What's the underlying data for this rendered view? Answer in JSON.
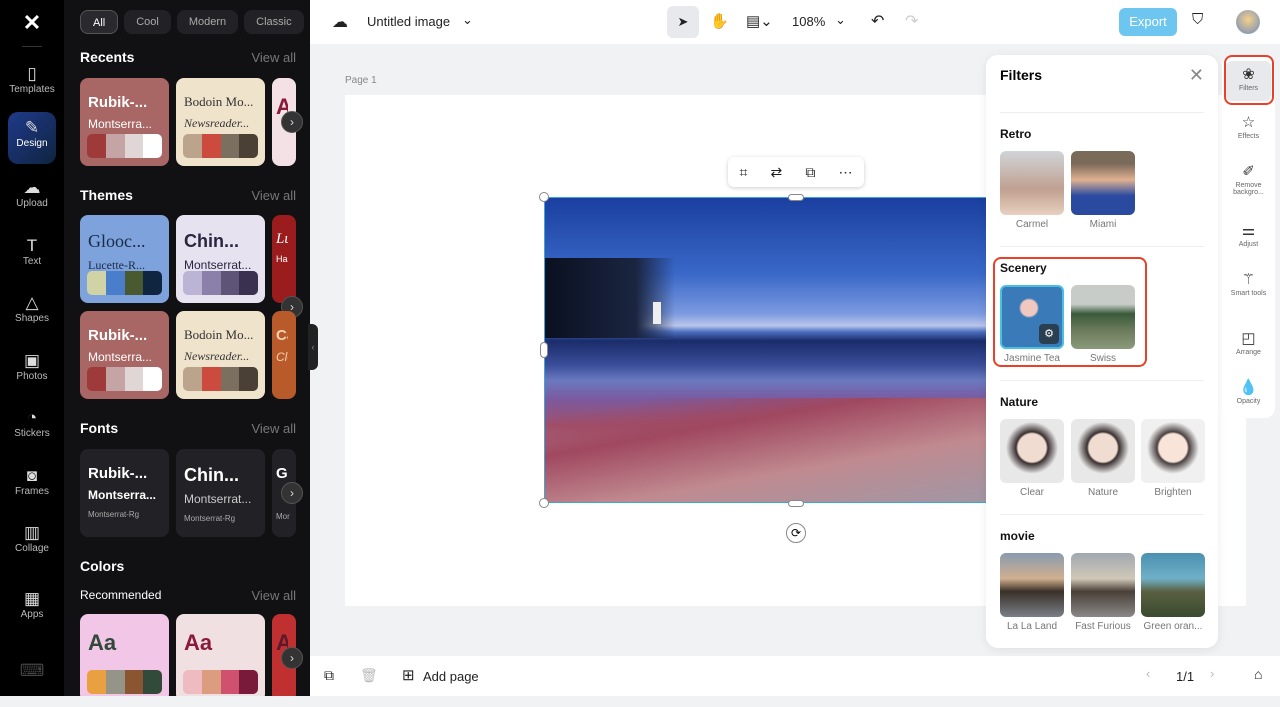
{
  "rail": {
    "items": [
      {
        "label": "Templates",
        "icon": "templates-icon"
      },
      {
        "label": "Design",
        "icon": "design-icon"
      },
      {
        "label": "Upload",
        "icon": "upload-icon"
      },
      {
        "label": "Text",
        "icon": "text-icon"
      },
      {
        "label": "Shapes",
        "icon": "shapes-icon"
      },
      {
        "label": "Photos",
        "icon": "photos-icon"
      },
      {
        "label": "Stickers",
        "icon": "stickers-icon"
      },
      {
        "label": "Frames",
        "icon": "frames-icon"
      },
      {
        "label": "Collage",
        "icon": "collage-icon"
      },
      {
        "label": "Apps",
        "icon": "apps-icon"
      }
    ]
  },
  "panel": {
    "chips": [
      "All",
      "Cool",
      "Modern",
      "Classic"
    ],
    "recents": "Recents",
    "themes": "Themes",
    "fonts": "Fonts",
    "colors": "Colors",
    "recommended": "Recommended",
    "view_all": "View all",
    "recent_cards": [
      {
        "t1": "Rubik-...",
        "t2": "Montserra..."
      },
      {
        "t1": "Bodoin Mo...",
        "t2": "Newsreader..."
      },
      {
        "t1": "A",
        "t2": ""
      }
    ],
    "theme_cards": [
      {
        "t1": "Glooc...",
        "t2": "Lucette-R..."
      },
      {
        "t1": "Chin...",
        "t2": "Montserrat..."
      },
      {
        "t1": "Lu",
        "t2": "Has"
      },
      {
        "t1": "Rubik-...",
        "t2": "Montserra..."
      },
      {
        "t1": "Bodoin Mo...",
        "t2": "Newsreader..."
      },
      {
        "t1": "Ca",
        "t2": "Cle"
      }
    ],
    "font_cards": [
      {
        "t1": "Rubik-...",
        "t2": "Montserra...",
        "t3": "Montserrat-Rg"
      },
      {
        "t1": "Chin...",
        "t2": "Montserrat...",
        "t3": "Montserrat-Rg"
      },
      {
        "t1": "Gu",
        "t2": "",
        "t3": "Mor"
      }
    ],
    "color_cards": [
      {
        "t1": "Aa"
      },
      {
        "t1": "Aa"
      },
      {
        "t1": "A"
      }
    ]
  },
  "top": {
    "title": "Untitled image",
    "zoom": "108%",
    "export": "Export"
  },
  "canvas": {
    "page_label": "Page 1"
  },
  "bottom": {
    "add_page": "Add page",
    "page_count": "1/1"
  },
  "filters": {
    "title": "Filters",
    "sections": [
      {
        "name": "Retro",
        "items": [
          "Carmel",
          "Miami"
        ]
      },
      {
        "name": "Scenery",
        "items": [
          "Jasmine Tea",
          "Swiss"
        ]
      },
      {
        "name": "Nature",
        "items": [
          "Clear",
          "Nature",
          "Brighten"
        ]
      },
      {
        "name": "movie",
        "items": [
          "La La Land",
          "Fast Furious",
          "Green oran..."
        ]
      }
    ]
  },
  "tools": [
    "Filters",
    "Effects",
    "Remove backgro...",
    "Adjust",
    "Smart tools",
    "Arrange",
    "Opacity"
  ],
  "colors": {
    "accent": "#3aa7d8",
    "export": "#6cc6f0",
    "highlight": "#e8402a"
  }
}
